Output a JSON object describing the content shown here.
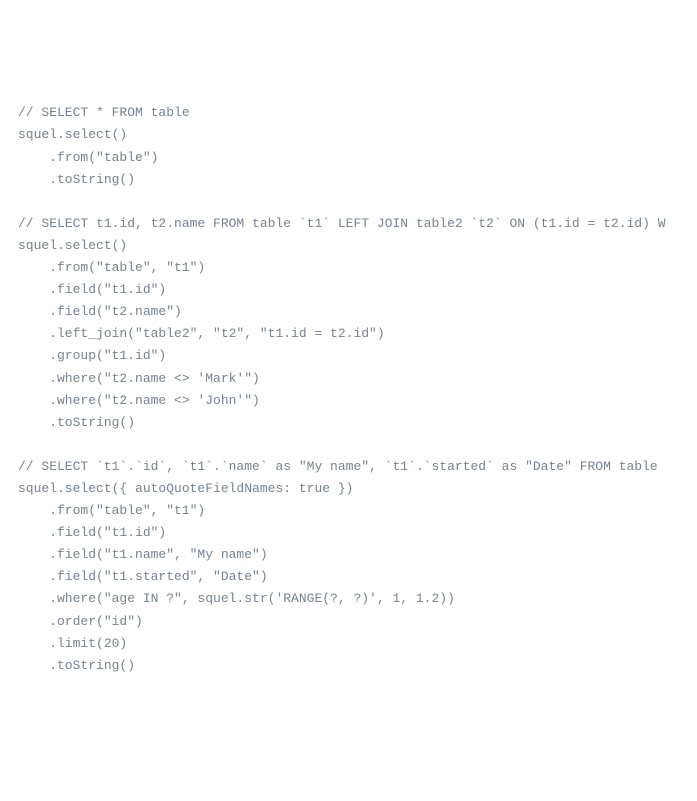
{
  "lines": [
    "// SELECT * FROM table",
    "squel.select()",
    "    .from(\"table\")",
    "    .toString()",
    "",
    "// SELECT t1.id, t2.name FROM table `t1` LEFT JOIN table2 `t2` ON (t1.id = t2.id) W",
    "squel.select()",
    "    .from(\"table\", \"t1\")",
    "    .field(\"t1.id\")",
    "    .field(\"t2.name\")",
    "    .left_join(\"table2\", \"t2\", \"t1.id = t2.id\")",
    "    .group(\"t1.id\")",
    "    .where(\"t2.name <> 'Mark'\")",
    "    .where(\"t2.name <> 'John'\")",
    "    .toString()",
    "",
    "// SELECT `t1`.`id`, `t1`.`name` as \"My name\", `t1`.`started` as \"Date\" FROM table ",
    "squel.select({ autoQuoteFieldNames: true })",
    "    .from(\"table\", \"t1\")",
    "    .field(\"t1.id\")",
    "    .field(\"t1.name\", \"My name\")",
    "    .field(\"t1.started\", \"Date\")",
    "    .where(\"age IN ?\", squel.str('RANGE(?, ?)', 1, 1.2))",
    "    .order(\"id\")",
    "    .limit(20)",
    "    .toString()"
  ]
}
